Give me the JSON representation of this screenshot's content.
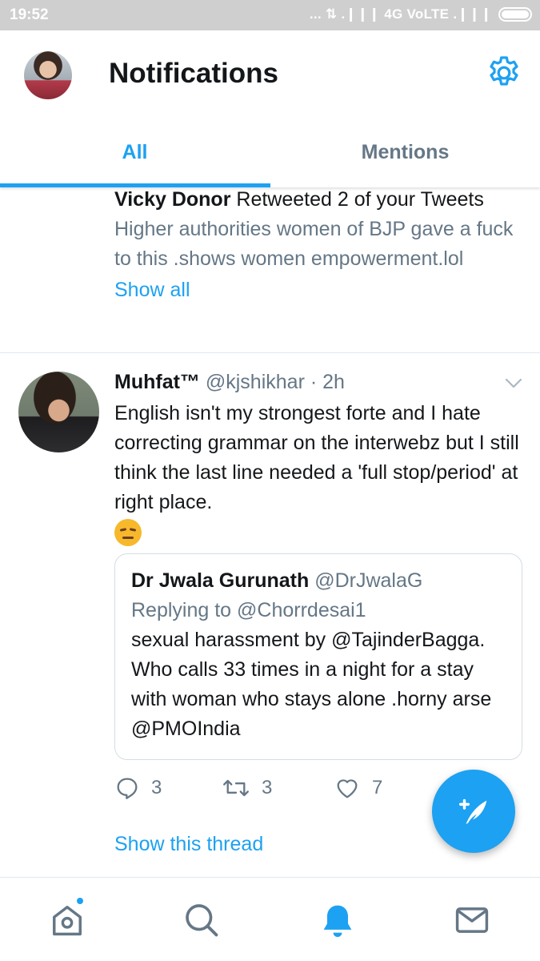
{
  "status_bar": {
    "time": "19:52",
    "network": "... ⇅ .❙❙❙ 4G VoLTE .❙❙❙"
  },
  "header": {
    "title": "Notifications",
    "settings_icon": "gear-icon"
  },
  "tabs": [
    {
      "label": "All",
      "active": true
    },
    {
      "label": "Mentions",
      "active": false
    }
  ],
  "retweet_notification": {
    "user": "Vicky Donor",
    "action": " Retweeted 2 of your Tweets",
    "body": "Higher authorities women of BJP gave a fuck to this .shows women empowerment.lol",
    "show_all": "Show all"
  },
  "tweet": {
    "name": "Muhfat™",
    "handle": "@kjshikhar",
    "time": " · 2h",
    "text": "English isn't my strongest forte and I hate correcting grammar on the interwebz but I still think the last line needed a 'full stop/period' at right place.",
    "emoji": "unamused-face",
    "quote": {
      "name": "Dr Jwala Gurunath",
      "handle": "@DrJwalaG",
      "replying": "Replying to @Chorrdesai1",
      "text": "sexual harassment by @TajinderBagga. Who calls 33 times in a night for a stay with woman who stays alone .horny arse @PMOIndia"
    },
    "actions": {
      "replies": "3",
      "retweets": "3",
      "likes": "7"
    },
    "show_thread": "Show this thread"
  },
  "bottom_nav": [
    "home-icon",
    "search-icon",
    "notifications-icon",
    "messages-icon"
  ],
  "colors": {
    "accent": "#1da1f2",
    "secondary_text": "#657786",
    "primary_text": "#14171a",
    "divider": "#e1e8ed"
  }
}
